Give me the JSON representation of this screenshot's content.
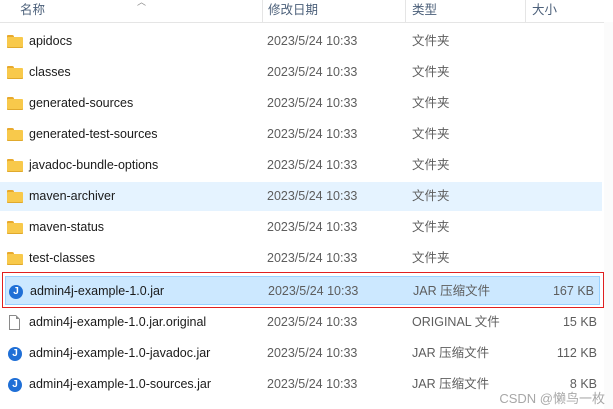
{
  "columns": {
    "name": "名称",
    "date": "修改日期",
    "type": "类型",
    "size": "大小"
  },
  "files": [
    {
      "icon": "folder-icon",
      "name": "apidocs",
      "date": "2023/5/24 10:33",
      "type": "文件夹",
      "size": ""
    },
    {
      "icon": "folder-icon",
      "name": "classes",
      "date": "2023/5/24 10:33",
      "type": "文件夹",
      "size": ""
    },
    {
      "icon": "folder-icon",
      "name": "generated-sources",
      "date": "2023/5/24 10:33",
      "type": "文件夹",
      "size": ""
    },
    {
      "icon": "folder-icon",
      "name": "generated-test-sources",
      "date": "2023/5/24 10:33",
      "type": "文件夹",
      "size": ""
    },
    {
      "icon": "folder-icon",
      "name": "javadoc-bundle-options",
      "date": "2023/5/24 10:33",
      "type": "文件夹",
      "size": ""
    },
    {
      "icon": "folder-icon",
      "name": "maven-archiver",
      "date": "2023/5/24 10:33",
      "type": "文件夹",
      "size": ""
    },
    {
      "icon": "folder-icon",
      "name": "maven-status",
      "date": "2023/5/24 10:33",
      "type": "文件夹",
      "size": ""
    },
    {
      "icon": "folder-icon",
      "name": "test-classes",
      "date": "2023/5/24 10:33",
      "type": "文件夹",
      "size": ""
    },
    {
      "icon": "jar-icon",
      "name": "admin4j-example-1.0.jar",
      "date": "2023/5/24 10:33",
      "type": "JAR 压缩文件",
      "size": "167 KB"
    },
    {
      "icon": "file-icon",
      "name": "admin4j-example-1.0.jar.original",
      "date": "2023/5/24 10:33",
      "type": "ORIGINAL 文件",
      "size": "15 KB"
    },
    {
      "icon": "jar-icon",
      "name": "admin4j-example-1.0-javadoc.jar",
      "date": "2023/5/24 10:33",
      "type": "JAR 压缩文件",
      "size": "112 KB"
    },
    {
      "icon": "jar-icon",
      "name": "admin4j-example-1.0-sources.jar",
      "date": "2023/5/24 10:33",
      "type": "JAR 压缩文件",
      "size": "8 KB"
    }
  ],
  "watermark": "CSDN @懒鸟一枚",
  "colors": {
    "selected_bg": "#cce8ff",
    "hover_bg": "#e5f3ff",
    "highlight_box": "#e02020",
    "folder": "#f8c94b",
    "jar": "#1f6fd6"
  }
}
